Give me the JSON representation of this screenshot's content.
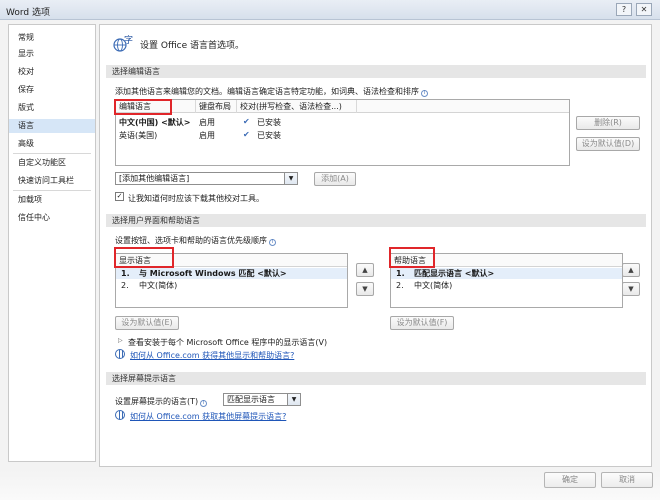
{
  "window": {
    "title": "Word 选项"
  },
  "sidebar": {
    "items": [
      {
        "label": "常规"
      },
      {
        "label": "显示"
      },
      {
        "label": "校对"
      },
      {
        "label": "保存"
      },
      {
        "label": "版式"
      },
      {
        "label": "语言",
        "active": true
      },
      {
        "label": "高级"
      },
      {
        "label": "自定义功能区"
      },
      {
        "label": "快速访问工具栏"
      },
      {
        "label": "加载项"
      },
      {
        "label": "信任中心"
      }
    ]
  },
  "header": {
    "text": "设置 Office 语言首选项。"
  },
  "editing": {
    "section_title": "选择编辑语言",
    "description": "添加其他语言来编辑您的文档。编辑语言确定语言特定功能，如词典、语法检查和排序",
    "columns": [
      "编辑语言",
      "键盘布局",
      "校对(拼写检查、语法检查...)"
    ],
    "rows": [
      {
        "language": "中文(中国) <默认>",
        "keyboard": "启用",
        "proofing": "已安装",
        "bold": true
      },
      {
        "language": "英语(美国)",
        "keyboard": "启用",
        "proofing": "已安装",
        "bold": false
      }
    ],
    "remove_button": "删除(R)",
    "set_default_button": "设为默认值(D)",
    "add_combo": "[添加其他编辑语言]",
    "add_button": "添加(A)",
    "checkbox_label": "让我知道何时应该下载其他校对工具。",
    "checkbox_checked": true
  },
  "ui_help": {
    "section_title": "选择用户界面和帮助语言",
    "description": "设置按钮、选项卡和帮助的语言优先级顺序",
    "display": {
      "header": "显示语言",
      "items": [
        {
          "num": "1.",
          "label": "与 Microsoft Windows 匹配 <默认>",
          "bold": true
        },
        {
          "num": "2.",
          "label": "中文(简体)",
          "bold": false
        }
      ],
      "set_default_button": "设为默认值(E)"
    },
    "help": {
      "header": "帮助语言",
      "items": [
        {
          "num": "1.",
          "label": "匹配显示语言 <默认>",
          "bold": true
        },
        {
          "num": "2.",
          "label": "中文(简体)",
          "bold": false
        }
      ],
      "set_default_button": "设为默认值(F)"
    },
    "expand_text": "查看安装于每个 Microsoft Office 程序中的显示语言(V)",
    "link": "如何从 Office.com 获得其他显示和帮助语言?"
  },
  "screentip": {
    "section_title": "选择屏幕提示语言",
    "label": "设置屏幕提示的语言(T)",
    "combo_value": "匹配显示语言",
    "link": "如何从 Office.com 获取其他屏幕提示语言?"
  },
  "footer": {
    "ok": "确定",
    "cancel": "取消"
  },
  "icons": {
    "arrow_up": "▲",
    "arrow_down": "▼",
    "combo_down": "▼",
    "check": "✓",
    "expander": "▷",
    "spell": "✔",
    "info": "i"
  },
  "colors": {
    "highlight_box": "#e0262a",
    "link": "#1f56b8",
    "active_nav": "#d6e6f7"
  }
}
